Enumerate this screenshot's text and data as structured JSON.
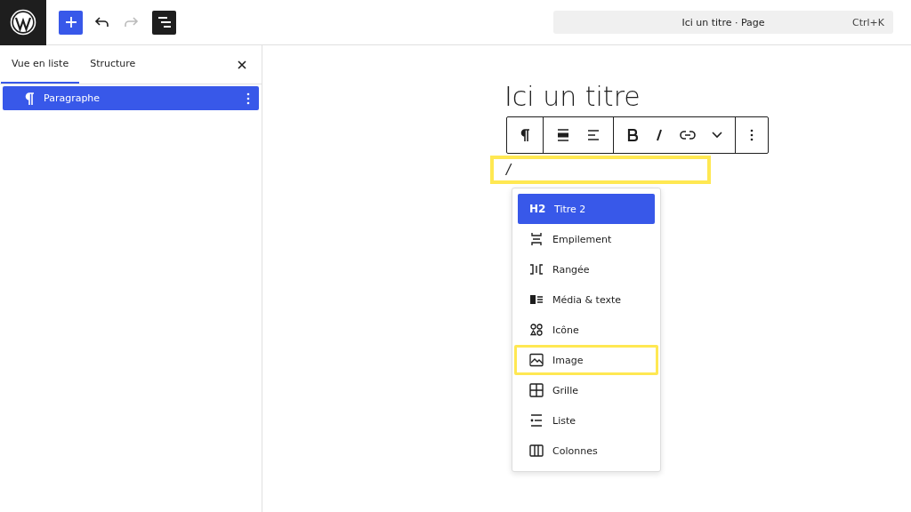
{
  "topbar": {
    "redo_disabled": true,
    "command_bar": {
      "title": "Ici un titre · Page",
      "shortcut": "Ctrl+K"
    }
  },
  "sidebar": {
    "tabs": [
      {
        "label": "Vue en liste",
        "selected": true
      },
      {
        "label": "Structure",
        "selected": false
      }
    ],
    "items": [
      {
        "label": "Paragraphe",
        "selected": true
      }
    ]
  },
  "editor": {
    "title": "Ici un titre",
    "input": {
      "value": "/",
      "highlighted": true
    }
  },
  "inserter": {
    "items": [
      {
        "badge": "H2",
        "label": "Titre 2",
        "selected": true,
        "highlighted": false
      },
      {
        "label": "Empilement",
        "selected": false,
        "highlighted": false
      },
      {
        "label": "Rangée",
        "selected": false,
        "highlighted": false
      },
      {
        "label": "Média & texte",
        "selected": false,
        "highlighted": false
      },
      {
        "label": "Icône",
        "selected": false,
        "highlighted": false
      },
      {
        "label": "Image",
        "selected": false,
        "highlighted": true
      },
      {
        "label": "Grille",
        "selected": false,
        "highlighted": false
      },
      {
        "label": "Liste",
        "selected": false,
        "highlighted": false
      },
      {
        "label": "Colonnes",
        "selected": false,
        "highlighted": false
      }
    ]
  }
}
